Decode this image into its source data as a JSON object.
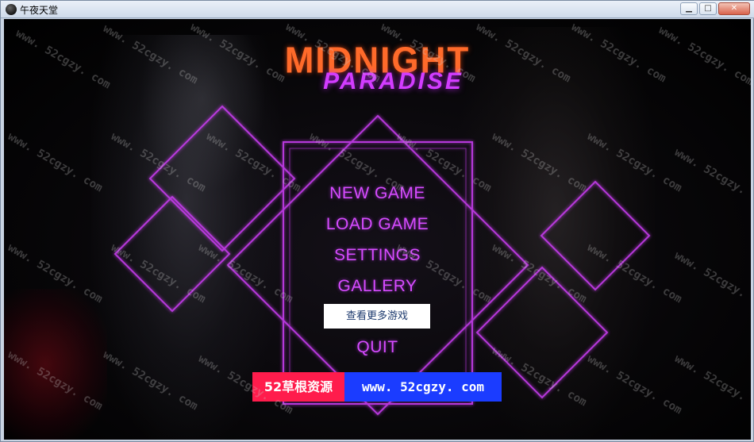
{
  "window": {
    "title": "午夜天堂",
    "minimize_glyph": "▁",
    "maximize_glyph": "□",
    "close_glyph": "✕"
  },
  "logo": {
    "line1": "MIDNIGHT",
    "line2": "PARADISE"
  },
  "menu": {
    "new_game": "NEW GAME",
    "load_game": "LOAD GAME",
    "settings": "SETTINGS",
    "gallery": "GALLERY",
    "more_games": "查看更多游戏",
    "quit": "QUIT"
  },
  "banner": {
    "site_name": "52草根资源",
    "site_url": "www. 52cgzy. com"
  },
  "watermark": "www. 52cgzy. com",
  "colors": {
    "neon_purple": "#d64bff",
    "logo_orange": "#ff6a2a",
    "banner_red": "#ff1c4c",
    "banner_blue": "#1b3cff"
  }
}
